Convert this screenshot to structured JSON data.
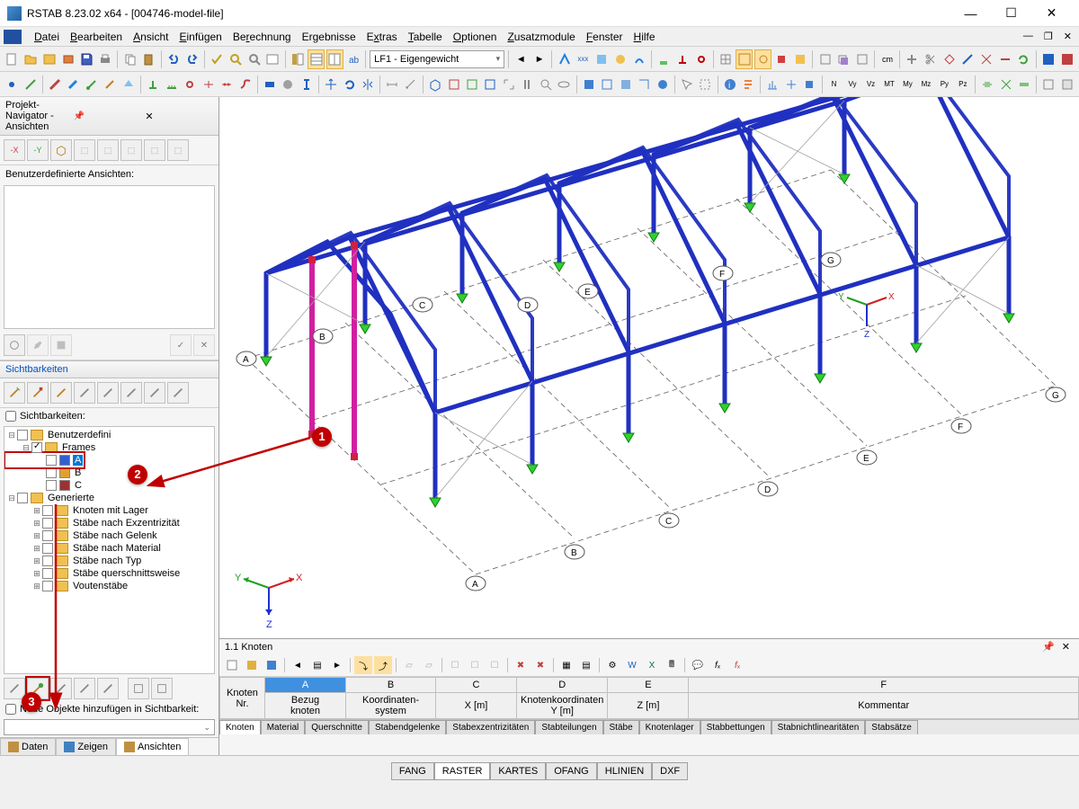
{
  "window": {
    "title": "RSTAB 8.23.02 x64 - [004746-model-file]",
    "minimize": "—",
    "maximize": "☐",
    "close": "✕"
  },
  "menu": {
    "items": [
      "Datei",
      "Bearbeiten",
      "Ansicht",
      "Einfügen",
      "Berechnung",
      "Ergebnisse",
      "Extras",
      "Tabelle",
      "Optionen",
      "Zusatzmodule",
      "Fenster",
      "Hilfe"
    ]
  },
  "loadcase_combo": "LF1 - Eigengewicht",
  "navigator": {
    "title": "Projekt-Navigator - Ansichten",
    "pin": "📌",
    "close": "✕",
    "userviews_label": "Benutzerdefinierte Ansichten:",
    "visibilities_title": "Sichtbarkeiten",
    "visibilities_check_label": "Sichtbarkeiten:",
    "tree": {
      "user_root": "Benutzerdefini",
      "frames": "Frames",
      "frame_items": [
        "A",
        "B",
        "C"
      ],
      "generated_root": "Generierte",
      "gen_items": [
        "Knoten mit Lager",
        "Stäbe nach Exzentrizität",
        "Stäbe nach Gelenk",
        "Stäbe nach Material",
        "Stäbe nach Typ",
        "Stäbe querschnittsweise",
        "Voutenstäbe"
      ]
    },
    "new_objects_label": "Neue Objekte hinzufügen in Sichtbarkeit:",
    "tabs": [
      "Daten",
      "Zeigen",
      "Ansichten"
    ]
  },
  "table_panel": {
    "title": "1.1 Knoten",
    "columns": {
      "nr": "Knoten\nNr.",
      "a_top": "A",
      "a_sub1": "Bezug",
      "a_sub2": "knoten",
      "b_top": "B",
      "b_sub1": "Koordinaten-",
      "b_sub2": "system",
      "c_top": "C",
      "c_sub2": "X [m]",
      "d_top": "D",
      "d_sub1": "Knotenkoordinaten",
      "d_sub2": "Y [m]",
      "e_top": "E",
      "e_sub2": "Z [m]",
      "f_top": "F",
      "f_sub2": "Kommentar"
    },
    "tabs": [
      "Knoten",
      "Material",
      "Querschnitte",
      "Stabendgelenke",
      "Stabexzentrizitäten",
      "Stabteilungen",
      "Stäbe",
      "Knotenlager",
      "Stabbettungen",
      "Stabnichtlinearitäten",
      "Stabsätze"
    ]
  },
  "status_tabs": [
    "FANG",
    "RASTER",
    "KARTES",
    "OFANG",
    "HLINIEN",
    "DXF"
  ],
  "annotations": {
    "one": "1",
    "two": "2",
    "three": "3"
  },
  "grid_labels": [
    "A",
    "B",
    "C",
    "D",
    "E",
    "F",
    "G"
  ],
  "axis": {
    "x": "X",
    "y": "Y",
    "z": "Z"
  }
}
